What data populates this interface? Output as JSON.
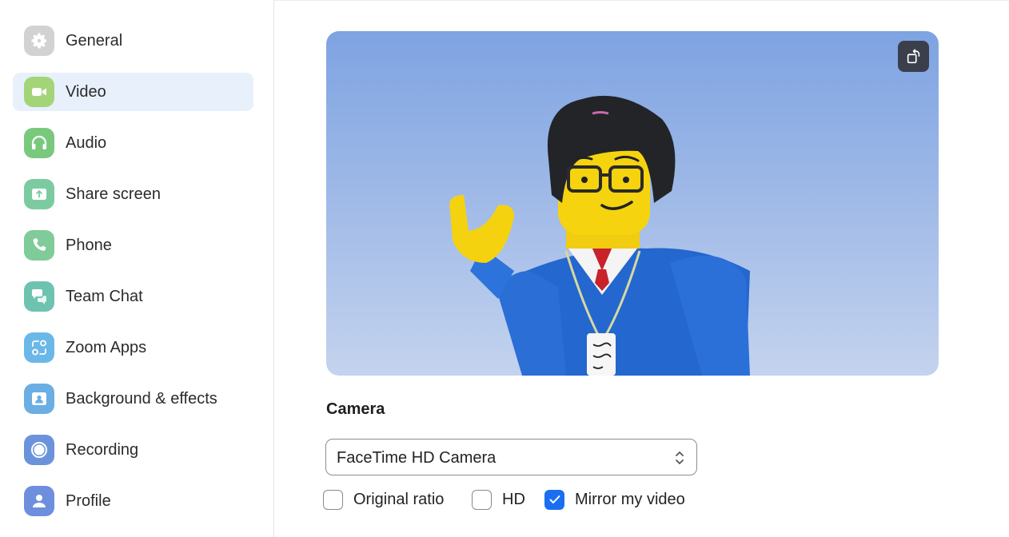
{
  "sidebar": {
    "items": [
      {
        "label": "General",
        "icon": "gear-icon",
        "color": "#d2d2d2",
        "active": false
      },
      {
        "label": "Video",
        "icon": "video-camera-icon",
        "color": "#a4d478",
        "active": true
      },
      {
        "label": "Audio",
        "icon": "headphones-icon",
        "color": "#79c97d",
        "active": false
      },
      {
        "label": "Share screen",
        "icon": "share-screen-icon",
        "color": "#7ccba0",
        "active": false
      },
      {
        "label": "Phone",
        "icon": "phone-icon",
        "color": "#7fcb99",
        "active": false
      },
      {
        "label": "Team Chat",
        "icon": "chat-icon",
        "color": "#6ec3b0",
        "active": false
      },
      {
        "label": "Zoom Apps",
        "icon": "apps-icon",
        "color": "#6bb8e8",
        "active": false
      },
      {
        "label": "Background & effects",
        "icon": "background-icon",
        "color": "#6aaee4",
        "active": false
      },
      {
        "label": "Recording",
        "icon": "recording-icon",
        "color": "#6a93dc",
        "active": false
      },
      {
        "label": "Profile",
        "icon": "profile-icon",
        "color": "#6d8fdd",
        "active": false
      }
    ]
  },
  "preview": {
    "rotate_icon": "rotate-icon"
  },
  "camera": {
    "section_label": "Camera",
    "selected_device": "FaceTime HD Camera"
  },
  "options": [
    {
      "label": "Original ratio",
      "checked": false
    },
    {
      "label": "HD",
      "checked": false
    },
    {
      "label": "Mirror my video",
      "checked": true
    }
  ],
  "colors": {
    "accent": "#1a6ff0",
    "active_nav_bg": "#e8f0fc"
  }
}
